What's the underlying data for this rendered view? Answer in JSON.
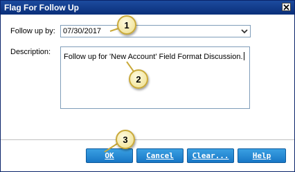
{
  "window": {
    "title": "Flag For Follow Up"
  },
  "form": {
    "follow_up_label": "Follow up by:",
    "follow_up_value": "07/30/2017",
    "description_label": "Description:",
    "description_value": "Follow up for 'New Account' Field Format Discussion."
  },
  "buttons": {
    "ok": "OK",
    "cancel": "Cancel",
    "clear": "Clear...",
    "help": "Help"
  },
  "callouts": [
    "1",
    "2",
    "3"
  ],
  "colors": {
    "titlebar": "#0a2f7a",
    "button": "#1877c6",
    "callout_fill": "#f3e6a2"
  }
}
